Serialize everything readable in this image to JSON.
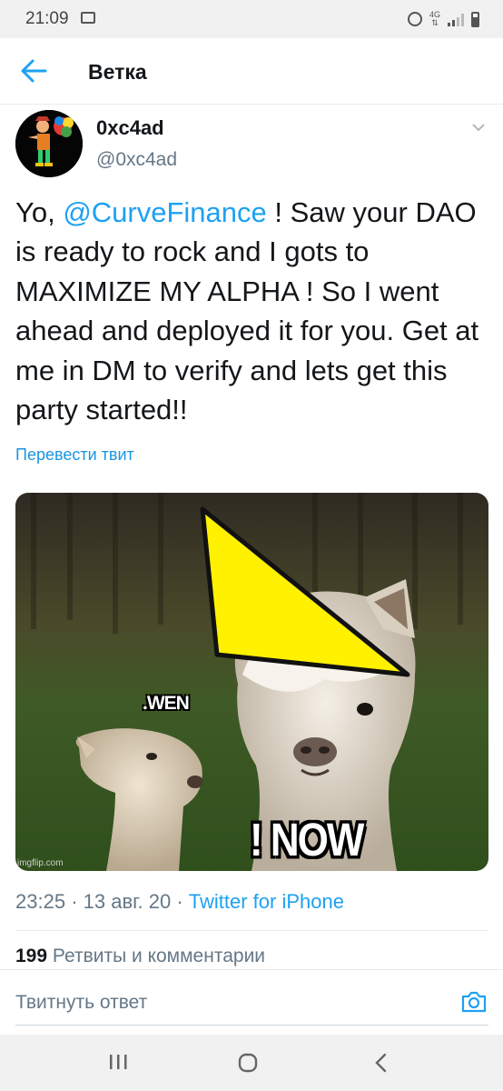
{
  "status_bar": {
    "time": "21:09",
    "network": "4G",
    "icons": [
      "image-icon",
      "alarm-icon",
      "signal-icon",
      "battery-icon"
    ]
  },
  "header": {
    "title": "Ветка",
    "back_icon": "arrow-left-icon"
  },
  "tweet": {
    "display_name": "0xc4ad",
    "handle": "@0xc4ad",
    "text_before_mention": "Yo, ",
    "mention": "@CurveFinance",
    "text_after_mention": " ! Saw your DAO is ready to rock and I gots to MAXIMIZE MY ALPHA ! So I went ahead and deployed it for you. Get at me in DM to verify and lets get this party started!!",
    "translate_label": "Перевести твит",
    "image": {
      "caption_top": ".WEN",
      "caption_bottom": "! NOW",
      "watermark": "imgflip.com"
    },
    "time": "23:25",
    "separator": "·",
    "date": "13 авг. 20",
    "source": "Twitter for iPhone",
    "retweets_count": "199",
    "retweets_label": "Ретвиты и комментарии"
  },
  "reply": {
    "placeholder": "Твитнуть ответ"
  },
  "colors": {
    "accent": "#1da1f2",
    "secondary_text": "#657786",
    "primary_text": "#14171a"
  }
}
